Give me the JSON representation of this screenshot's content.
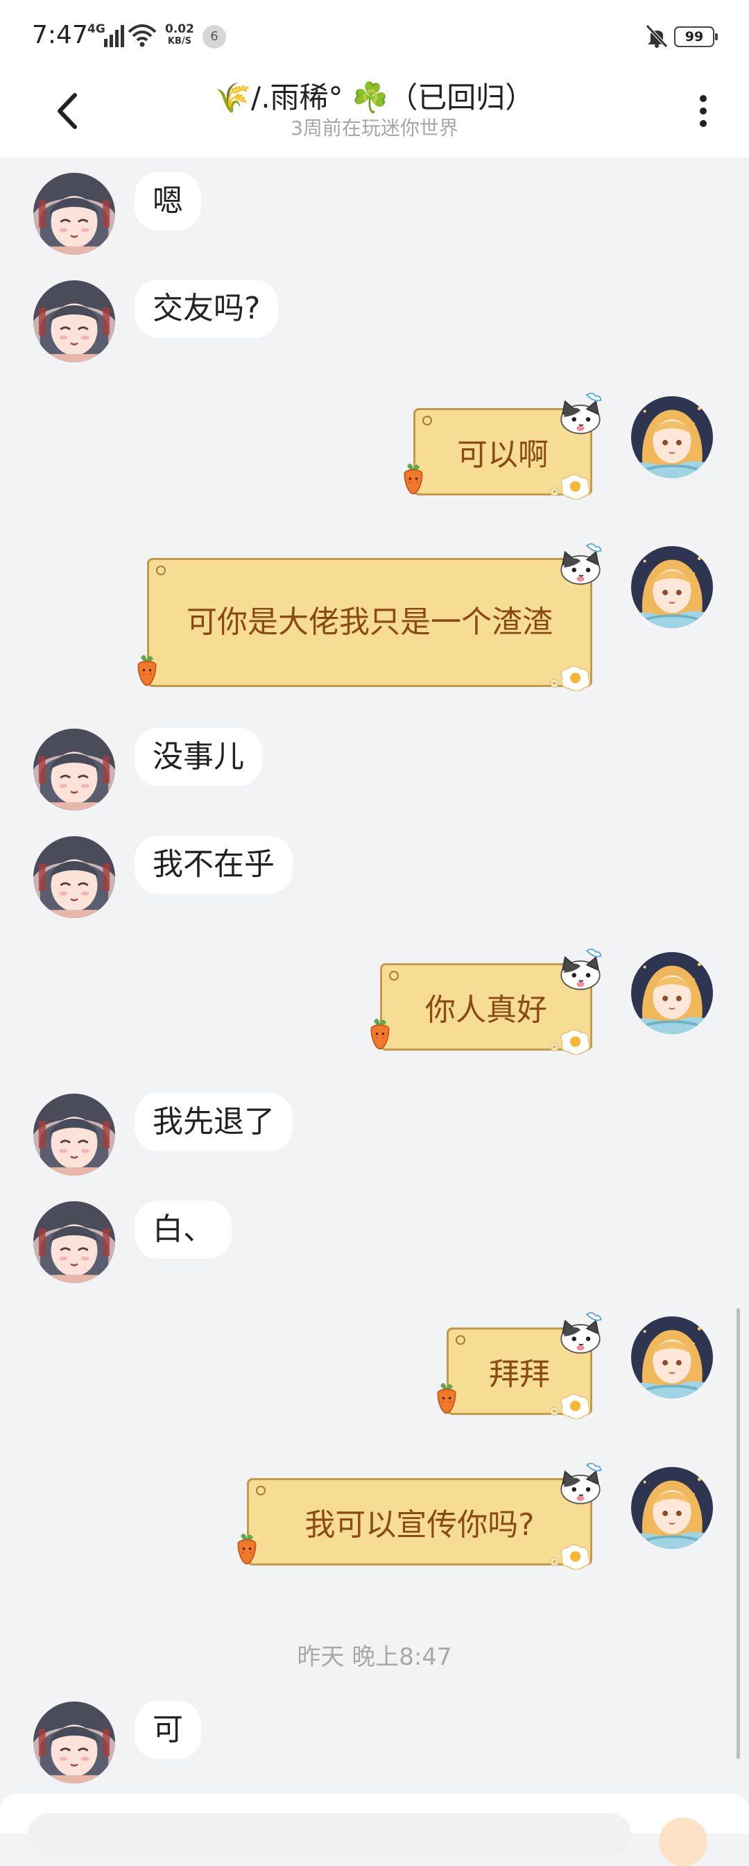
{
  "status_bar": {
    "time": "7:47",
    "network": "4G",
    "speed_value": "0.02",
    "speed_unit": "KB/S",
    "notif_count": "6",
    "battery": "99"
  },
  "header": {
    "title": "🌾/.雨稀°  ☘️（已回归）",
    "subtitle": "3周前在玩迷你世界"
  },
  "messages": [
    {
      "side": "in",
      "text": "嗯"
    },
    {
      "side": "in",
      "text": "交友吗?"
    },
    {
      "side": "out",
      "text": "可以啊"
    },
    {
      "side": "out",
      "text": "可你是大佬我只是一个渣渣"
    },
    {
      "side": "in",
      "text": "没事儿"
    },
    {
      "side": "in",
      "text": "我不在乎"
    },
    {
      "side": "out",
      "text": "你人真好"
    },
    {
      "side": "in",
      "text": "我先退了"
    },
    {
      "side": "in",
      "text": "白、"
    },
    {
      "side": "out",
      "text": "拜拜"
    },
    {
      "side": "out",
      "text": "我可以宣传你吗?"
    },
    {
      "side": "in",
      "text": "可"
    }
  ],
  "timestamp": "昨天 晚上8:47",
  "colors": {
    "bg": "#f2f3f5",
    "bubble_out": "#f7dc93",
    "bubble_out_border": "#c39a4b",
    "bubble_out_text": "#8a4b12"
  }
}
